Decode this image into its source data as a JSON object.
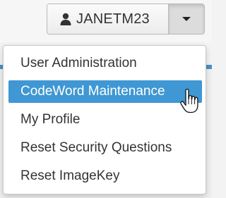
{
  "user_menu": {
    "username": "JANETM23",
    "user_icon": "user-icon",
    "caret_icon": "caret-down-icon"
  },
  "dropdown": {
    "items": [
      {
        "label": "User Administration"
      },
      {
        "label": "CodeWord Maintenance",
        "active": true
      },
      {
        "label": "My Profile"
      },
      {
        "label": "Reset Security Questions"
      },
      {
        "label": "Reset ImageKey"
      }
    ],
    "active_color": "#3f97d3"
  },
  "cursor": "hand-pointer-cursor-icon"
}
